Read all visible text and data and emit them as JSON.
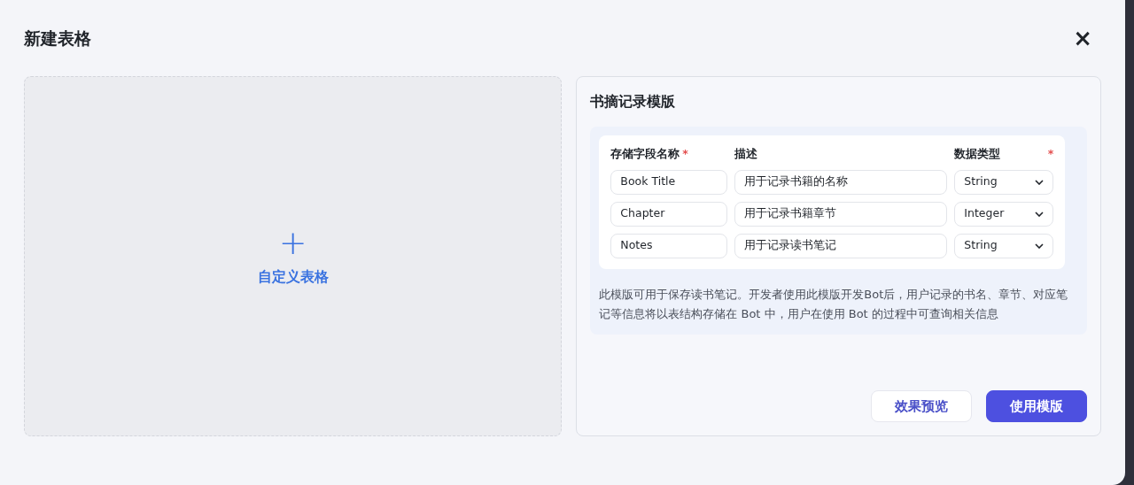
{
  "dialog": {
    "title": "新建表格",
    "close": "×"
  },
  "custom_table": {
    "icon": "+",
    "label": "自定义表格"
  },
  "template": {
    "title": "书摘记录模版",
    "columns": [
      {
        "label": "存储字段名称",
        "mark": "*"
      },
      {
        "label": "描述"
      },
      {
        "label": "数据类型",
        "mark": "*"
      }
    ],
    "rows": [
      {
        "name": "Book Title",
        "description": "用于记录书籍的名称",
        "type": "String"
      },
      {
        "name": "Chapter",
        "description": "用于记录书籍章节",
        "type": "Integer"
      },
      {
        "name": "Notes",
        "description": "用于记录读书笔记",
        "type": "String"
      }
    ],
    "description": "此模版可用于保存读书笔记。开发者使用此模版开发Bot后，用户记录的书名、章节、对应笔记等信息将以表结构存储在 Bot 中，用户在使用 Bot 的过程中可查询相关信息",
    "buttons": [
      {
        "label": "效果预览",
        "kind": "secondary"
      },
      {
        "label": "使用模版",
        "kind": "primary"
      }
    ]
  }
}
